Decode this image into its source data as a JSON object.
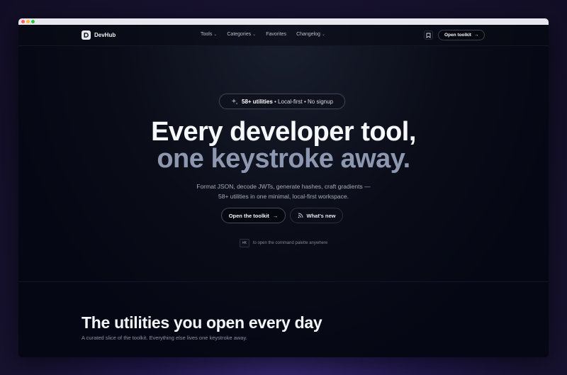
{
  "nav": {
    "brand": "DevHub",
    "links": [
      {
        "label": "Tools",
        "dropdown": true
      },
      {
        "label": "Categories",
        "dropdown": true
      },
      {
        "label": "Favorites",
        "dropdown": false
      },
      {
        "label": "Changelog",
        "dropdown": true
      }
    ],
    "cta_label": "Open toolkit"
  },
  "badge": {
    "count": "58+ utilities",
    "rest": " • Local-first • No signup",
    "icon": "sparkles-icon"
  },
  "hero": {
    "line1": "Every developer tool,",
    "line2": "one keystroke away.",
    "sub_line1": "Format JSON, decode JWTs, generate hashes, craft gradients —",
    "sub_line2": "58+ utilities in one minimal, local-first workspace."
  },
  "buttons": {
    "primary": "Open the toolkit",
    "secondary": "What's new"
  },
  "hint": {
    "key": "⌘K",
    "text": "to open the command palette anywhere"
  },
  "section": {
    "title": "The utilities you open every day",
    "subtitle": "A curated slice of the toolkit. Everything else lives one keystroke away."
  }
}
